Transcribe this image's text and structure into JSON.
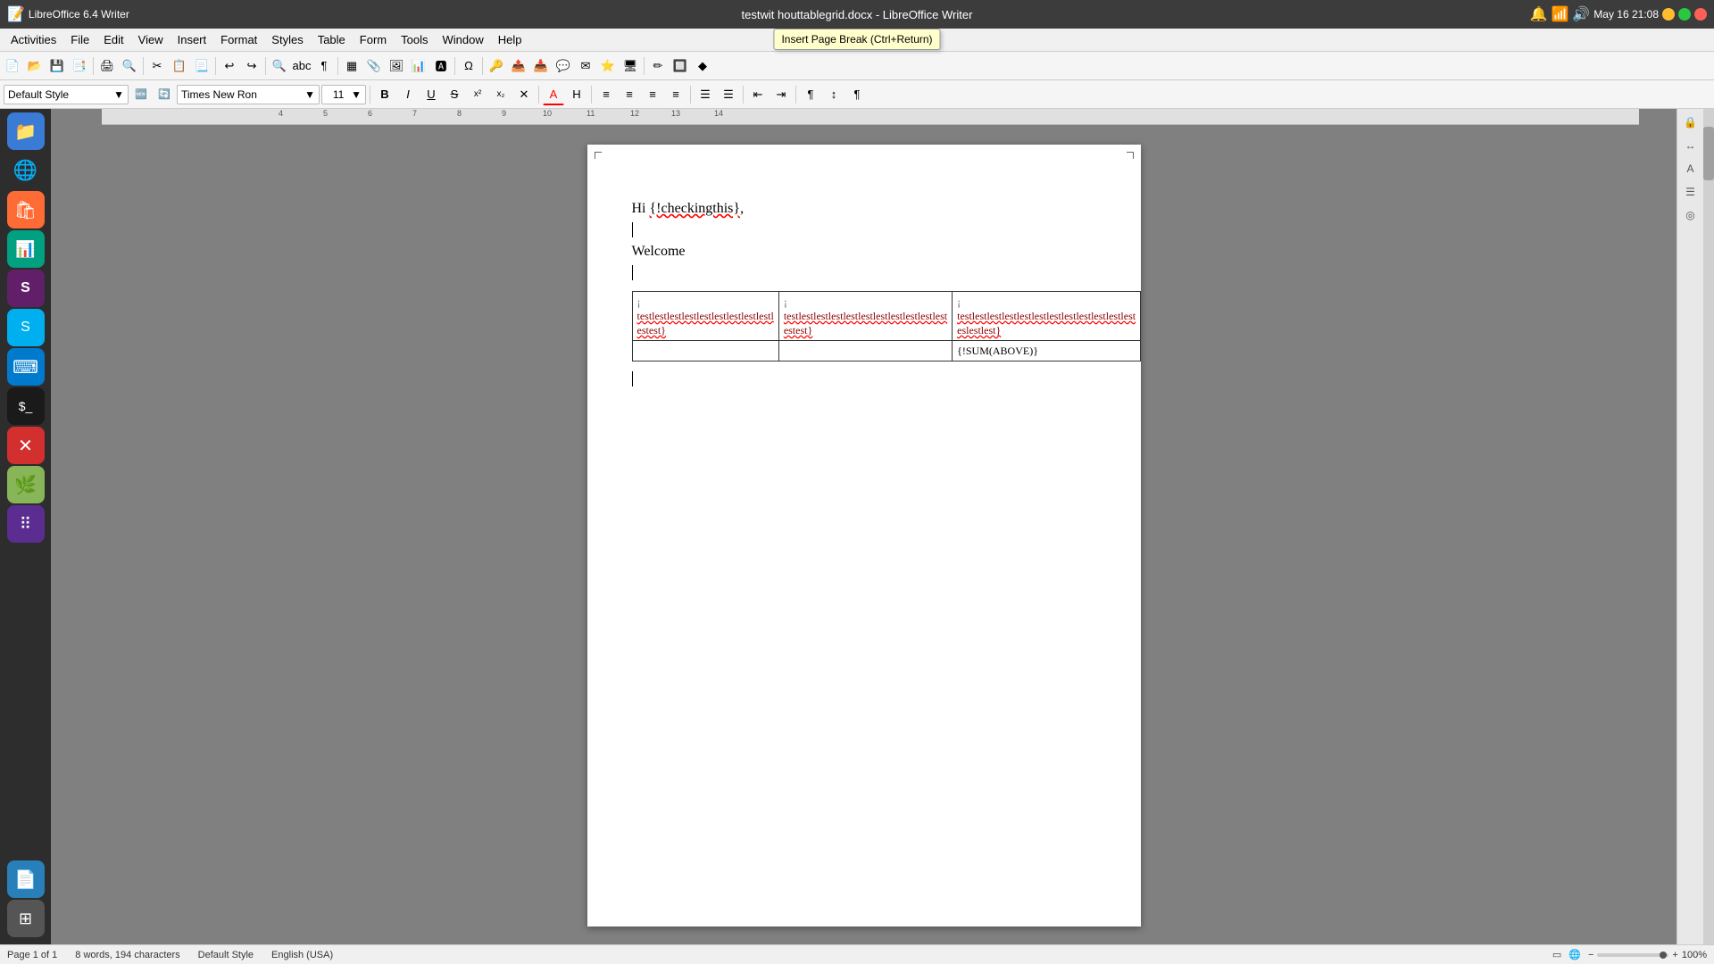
{
  "titlebar": {
    "title": "testwit houttablegrid.docx - LibreOffice Writer",
    "app_name": "LibreOffice 6.4 Writer"
  },
  "tooltip": {
    "text": "Insert Page Break (Ctrl+Return)"
  },
  "menu": {
    "items": [
      "Activities",
      "File",
      "Edit",
      "View",
      "Insert",
      "Format",
      "Styles",
      "Table",
      "Form",
      "Tools",
      "Window",
      "Help"
    ]
  },
  "toolbar1": {
    "buttons": [
      "☰",
      "📄",
      "📂",
      "💾",
      "📑",
      "🖨",
      "🔍",
      "✂",
      "📋",
      "📃",
      "↩",
      "↪",
      "🔍",
      "abc",
      "¶",
      "▦",
      "📎",
      "🖼",
      "📊",
      "🅰",
      "💡",
      "Ω",
      "🔑",
      "📤",
      "📥",
      "💬",
      "✉",
      "⭐",
      "🖥",
      "💬",
      "✏",
      "🔲",
      "◆"
    ]
  },
  "formatbar": {
    "style": "Default Style",
    "font": "Times New Ron",
    "size": "11",
    "buttons": {
      "bold": "B",
      "italic": "I",
      "underline": "U",
      "strikethrough": "S",
      "superscript": "x²",
      "subscript": "x₂",
      "clear": "✕",
      "fontcolor": "A",
      "highlight": "H",
      "align_left": "≡",
      "align_center": "≡",
      "align_right": "≡",
      "align_justify": "≡",
      "list_bullet": "☰",
      "list_number": "☰",
      "outdent": "⇤",
      "indent": "⇥",
      "paragraph": "¶",
      "linespace": "↕",
      "paragraph2": "¶"
    }
  },
  "document": {
    "line1": "Hi {!checkingthis},",
    "line2": "",
    "line3": "Welcome",
    "line4": "",
    "table": {
      "rows": [
        [
          "{!\ntestlestlestlestlestlestlestlestlestl\nestest}",
          "{!\ntestlestlestlestlestlestlestlestlestlestlest\nestest}",
          "{!\ntestlestlestlestlestlestlestlestlestlestlestlest\nestest}"
        ],
        [
          "",
          "",
          "{!SUM(ABOVE)}"
        ]
      ]
    }
  },
  "statusbar": {
    "page": "Page 1 of 1",
    "words": "8 words, 194 characters",
    "style": "Default Style",
    "language": "English (USA)",
    "zoom": "100%"
  },
  "sidebar_apps": [
    {
      "name": "Files",
      "icon": "📁",
      "color": "#3a7bd5"
    },
    {
      "name": "Chrome",
      "icon": "🌐",
      "color": "transparent"
    },
    {
      "name": "Software",
      "icon": "🛍",
      "color": "#ff6b35"
    },
    {
      "name": "LibreOffice",
      "icon": "📊",
      "color": "#00a500"
    },
    {
      "name": "Slack",
      "icon": "S",
      "color": "#611f69"
    },
    {
      "name": "Skype",
      "icon": "S",
      "color": "#00aff0"
    },
    {
      "name": "VSCode",
      "icon": "⌨",
      "color": "#007acc"
    },
    {
      "name": "Terminal",
      "icon": "⬛",
      "color": "#1a1a1a"
    },
    {
      "name": "Circle-X",
      "icon": "✕",
      "color": "#e74c3c"
    },
    {
      "name": "Mint",
      "icon": "🌿",
      "color": "#87b557"
    },
    {
      "name": "Dots",
      "icon": "⠿",
      "color": "#6c3483"
    },
    {
      "name": "Document",
      "icon": "📄",
      "color": "#2980b9"
    },
    {
      "name": "Grid",
      "icon": "⊞",
      "color": "#555"
    }
  ],
  "right_sidebar": {
    "icons": [
      "🔒",
      "↔",
      "A",
      "☰",
      "◎"
    ]
  },
  "system": {
    "time": "May 16  21:08",
    "date": ""
  }
}
